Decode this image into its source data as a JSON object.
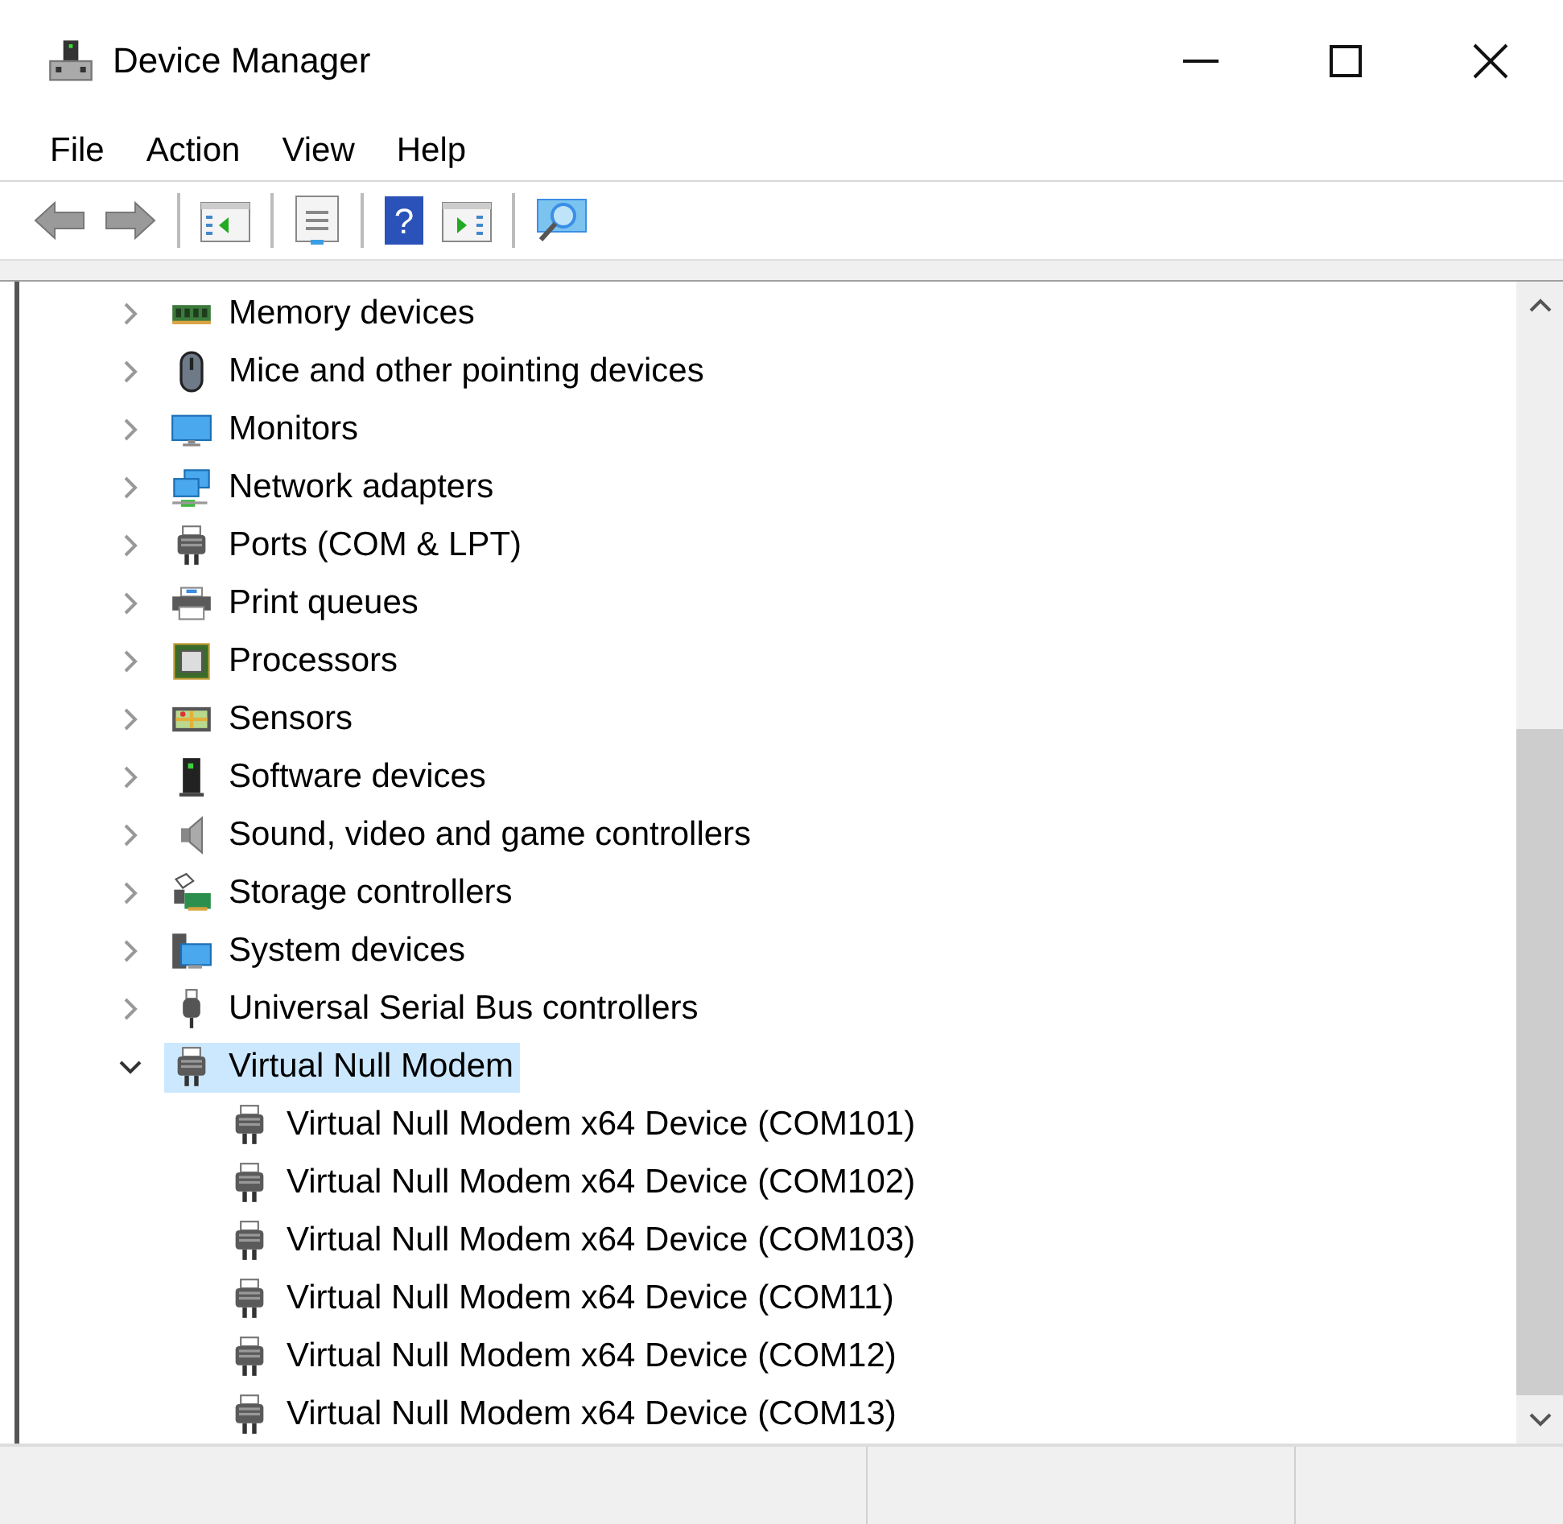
{
  "window": {
    "title": "Device Manager"
  },
  "menu": [
    "File",
    "Action",
    "View",
    "Help"
  ],
  "toolbar": {
    "help_glyph": "?"
  },
  "tree": [
    {
      "label": "Memory devices",
      "kind": "memory",
      "expanded": false,
      "selected": false
    },
    {
      "label": "Mice and other pointing devices",
      "kind": "mouse",
      "expanded": false,
      "selected": false
    },
    {
      "label": "Monitors",
      "kind": "monitor",
      "expanded": false,
      "selected": false
    },
    {
      "label": "Network adapters",
      "kind": "network",
      "expanded": false,
      "selected": false
    },
    {
      "label": "Ports (COM & LPT)",
      "kind": "port",
      "expanded": false,
      "selected": false
    },
    {
      "label": "Print queues",
      "kind": "printer",
      "expanded": false,
      "selected": false
    },
    {
      "label": "Processors",
      "kind": "processor",
      "expanded": false,
      "selected": false
    },
    {
      "label": "Sensors",
      "kind": "sensor",
      "expanded": false,
      "selected": false
    },
    {
      "label": "Software devices",
      "kind": "software",
      "expanded": false,
      "selected": false
    },
    {
      "label": "Sound, video and game controllers",
      "kind": "sound",
      "expanded": false,
      "selected": false
    },
    {
      "label": "Storage controllers",
      "kind": "storage",
      "expanded": false,
      "selected": false
    },
    {
      "label": "System devices",
      "kind": "system",
      "expanded": false,
      "selected": false
    },
    {
      "label": "Universal Serial Bus controllers",
      "kind": "usb",
      "expanded": false,
      "selected": false
    },
    {
      "label": "Virtual Null Modem",
      "kind": "port",
      "expanded": true,
      "selected": true,
      "children": [
        {
          "label": "Virtual Null Modem x64 Device (COM101)",
          "kind": "port",
          "selected": false
        },
        {
          "label": "Virtual Null Modem x64 Device (COM102)",
          "kind": "port",
          "selected": false
        },
        {
          "label": "Virtual Null Modem x64 Device (COM103)",
          "kind": "port",
          "selected": false
        },
        {
          "label": "Virtual Null Modem x64 Device (COM11)",
          "kind": "port",
          "selected": false
        },
        {
          "label": "Virtual Null Modem x64 Device (COM12)",
          "kind": "port",
          "selected": false
        },
        {
          "label": "Virtual Null Modem x64 Device (COM13)",
          "kind": "port",
          "selected": false
        }
      ]
    }
  ]
}
